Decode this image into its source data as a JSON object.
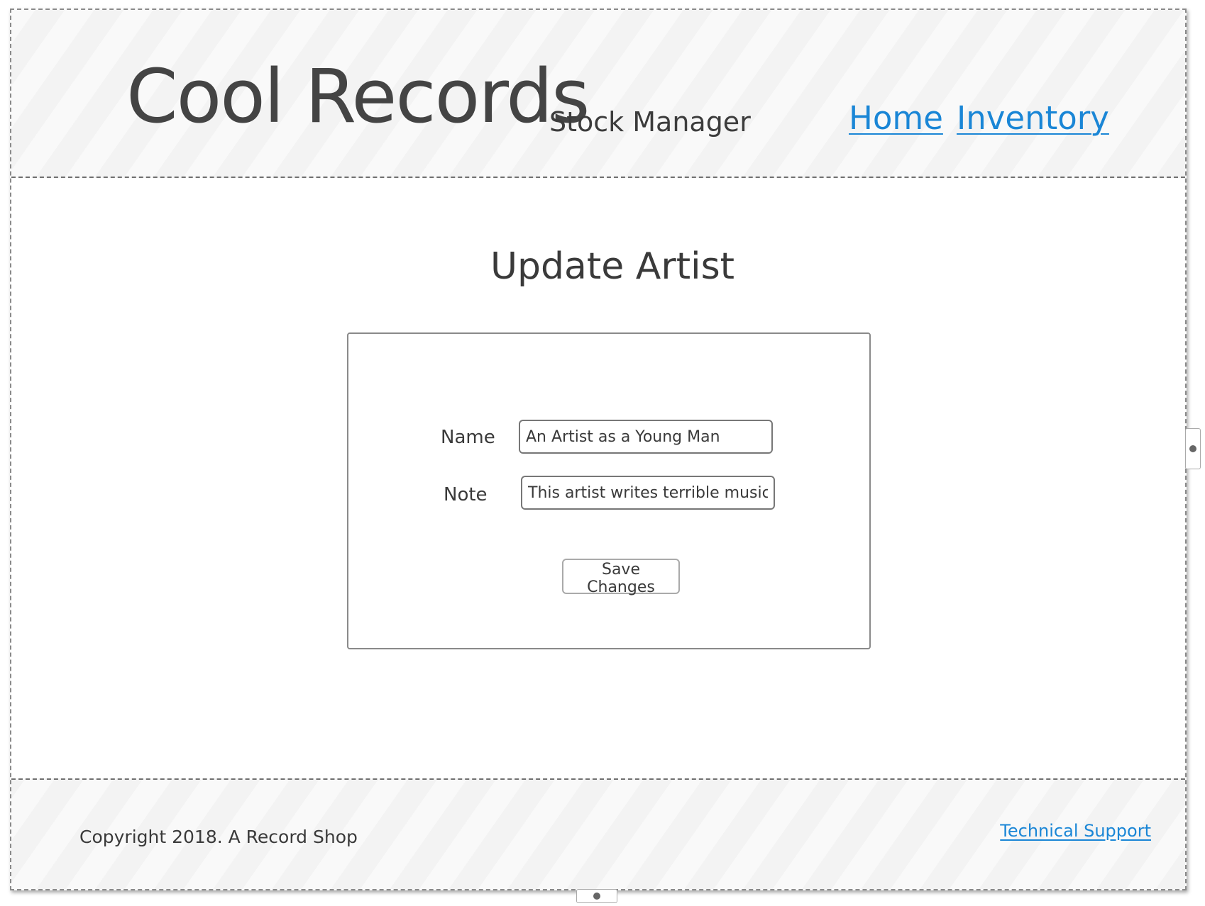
{
  "header": {
    "brand": "Cool Records",
    "subtitle": "Stock Manager",
    "nav": [
      {
        "label": "Home"
      },
      {
        "label": "Inventory"
      }
    ]
  },
  "main": {
    "title": "Update Artist",
    "form": {
      "name_label": "Name",
      "name_value": "An Artist as a Young Man",
      "note_label": "Note",
      "note_value": "This artist writes terrible music",
      "save_label": "Save Changes"
    }
  },
  "footer": {
    "copyright": "Copyright 2018. A Record Shop",
    "support_link": "Technical Support"
  },
  "colors": {
    "link": "#1a86d6",
    "text": "#3a3a3a",
    "border": "#8a8a8a"
  }
}
